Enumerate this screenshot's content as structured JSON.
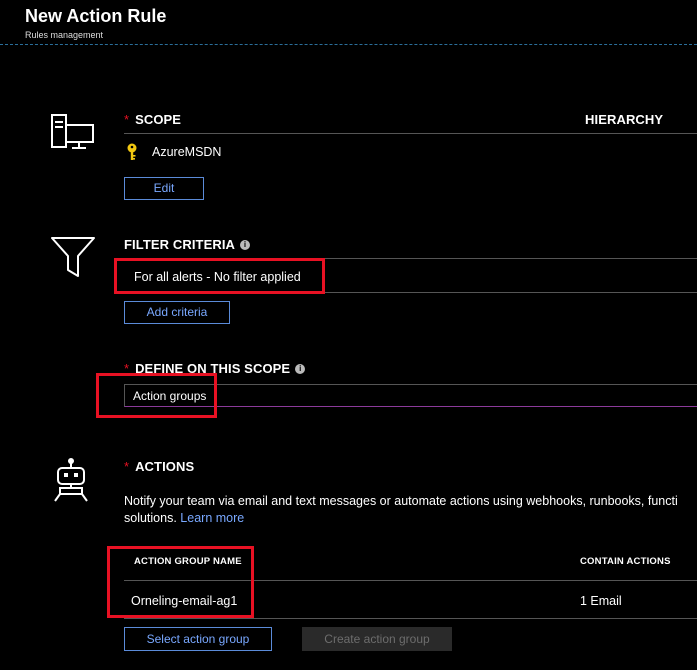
{
  "header": {
    "title": "New Action Rule",
    "subtitle": "Rules management"
  },
  "scope": {
    "required_mark": "*",
    "label": "SCOPE",
    "hierarchy_label": "HIERARCHY",
    "resource_name": "AzureMSDN",
    "resource_icon": "key-icon",
    "edit_label": "Edit"
  },
  "filter": {
    "label": "FILTER CRITERIA",
    "info": "i",
    "value": "For all alerts - No filter applied",
    "add_label": "Add criteria"
  },
  "define": {
    "required_mark": "*",
    "label": "DEFINE ON THIS SCOPE",
    "info": "i",
    "selected_value": "Action groups"
  },
  "actions": {
    "required_mark": "*",
    "label": "ACTIONS",
    "description": "Notify your team via email and text messages or automate actions using webhooks, runbooks, functions, logic apps or integrating with external ITSM solutions.",
    "description_line1": "Notify your team via email and text messages or automate actions using webhooks, runbooks, functi",
    "description_line2": "solutions.",
    "learn_more": "Learn more",
    "table": {
      "columns": [
        "ACTION GROUP NAME",
        "CONTAIN ACTIONS"
      ],
      "rows": [
        {
          "name": "Orneling-email-ag1",
          "contains": "1 Email"
        }
      ]
    },
    "select_label": "Select action group",
    "create_label": "Create action group"
  },
  "colors": {
    "accent": "#79a8ff",
    "required": "#e81123",
    "highlight": "#e81123",
    "define_underline": "#8b3a9a"
  }
}
